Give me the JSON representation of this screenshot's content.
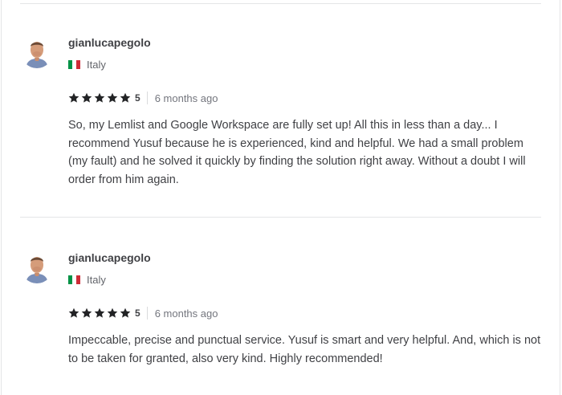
{
  "colors": {
    "divider": "#e4e5e7",
    "star": "#222325",
    "flag": [
      "#009246",
      "#ffffff",
      "#ce2b37"
    ]
  },
  "reviews": [
    {
      "username": "gianlucapegolo",
      "avatar_icon": "user-avatar",
      "country_flag_icon": "italy-flag-icon",
      "country": "Italy",
      "stars": 5,
      "score": "5",
      "time_ago": "6 months ago",
      "text": "So, my Lemlist and Google Workspace are fully set up! All this in less than a day... I recommend Yusuf because he is experienced, kind and helpful. We had a small problem (my fault) and he solved it quickly by finding the solution right away. Without a doubt I will order from him again."
    },
    {
      "username": "gianlucapegolo",
      "avatar_icon": "user-avatar",
      "country_flag_icon": "italy-flag-icon",
      "country": "Italy",
      "stars": 5,
      "score": "5",
      "time_ago": "6 months ago",
      "text": "Impeccable, precise and punctual service. Yusuf is smart and very helpful. And, which is not to be taken for granted, also very kind. Highly recommended!"
    }
  ]
}
